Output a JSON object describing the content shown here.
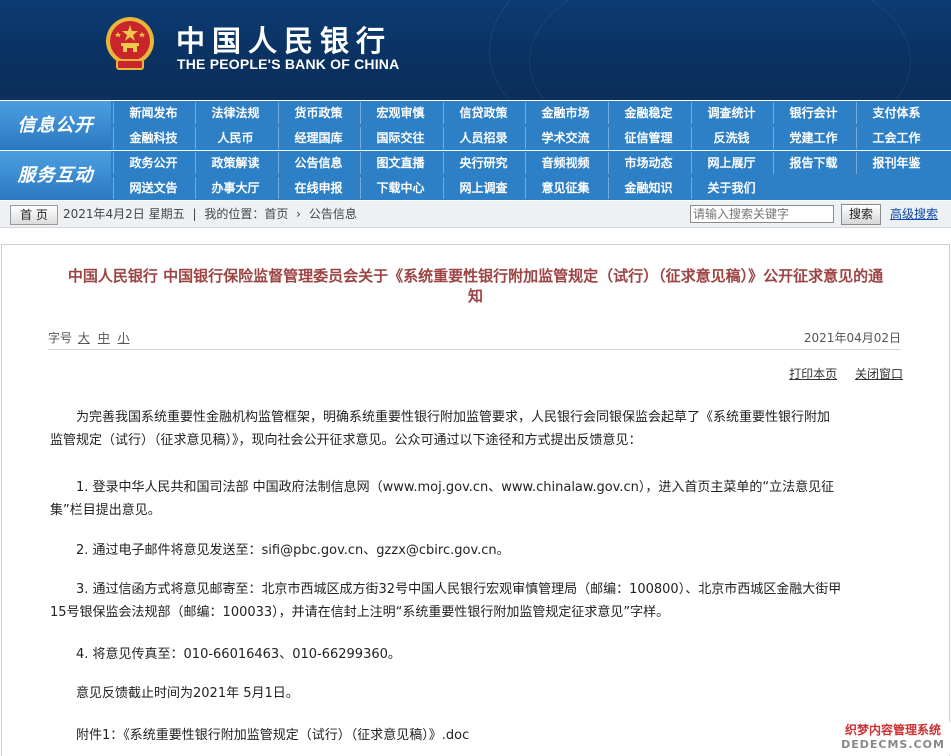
{
  "header": {
    "title_cn": "中国人民银行",
    "title_en": "THE PEOPLE'S BANK OF CHINA"
  },
  "nav": {
    "section1_label": "信息公开",
    "section1_row1": [
      "新闻发布",
      "法律法规",
      "货币政策",
      "宏观审慎",
      "信贷政策",
      "金融市场",
      "金融稳定",
      "调查统计",
      "银行会计",
      "支付体系"
    ],
    "section1_row2": [
      "金融科技",
      "人民币",
      "经理国库",
      "国际交往",
      "人员招录",
      "学术交流",
      "征信管理",
      "反洗钱",
      "党建工作",
      "工会工作"
    ],
    "section2_label": "服务互动",
    "section2_row1": [
      "政务公开",
      "政策解读",
      "公告信息",
      "图文直播",
      "央行研究",
      "音频视频",
      "市场动态",
      "网上展厅",
      "报告下载",
      "报刊年鉴"
    ],
    "section2_row2": [
      "网送文告",
      "办事大厅",
      "在线申报",
      "下载中心",
      "网上调查",
      "意见征集",
      "金融知识",
      "关于我们"
    ]
  },
  "breadcrumb": {
    "home_button": "首 页",
    "date": "2021年4月2日 星期五",
    "sep": "|",
    "location_label": "我的位置：首页",
    "arrow": "›",
    "current": "公告信息",
    "search_placeholder": "请输入搜索关键字",
    "search_button": "搜索",
    "advanced_search": "高级搜索"
  },
  "article": {
    "title_line1": "中国人民银行  中国银行保险监督管理委员会关于《系统重要性银行附加监管规定（试行）（征求意见稿）》公开征求意见的通",
    "title_line2": "知",
    "font_size_label": "字号",
    "font_large": "大",
    "font_medium": "中",
    "font_small": "小",
    "date": "2021年04月02日",
    "print_link": "打印本页",
    "close_link": "关闭窗口",
    "paragraphs": [
      {
        "l1": "为完善我国系统重要性金融机构监管框架，明确系统重要性银行附加监管要求，人民银行会同银保监会起草了《系统重要性银行附加",
        "l2": "监管规定（试行）（征求意见稿）》，现向社会公开征求意见。公众可通过以下途径和方式提出反馈意见："
      },
      {
        "l1": "1. 登录中华人民共和国司法部 中国政府法制信息网（www.moj.gov.cn、www.chinalaw.gov.cn），进入首页主菜单的“立法意见征",
        "l2": "集”栏目提出意见。"
      },
      {
        "l1": "2. 通过电子邮件将意见发送至：sifi@pbc.gov.cn、gzzx@cbirc.gov.cn。",
        "l2": ""
      },
      {
        "l1": "3. 通过信函方式将意见邮寄至：北京市西城区成方街32号中国人民银行宏观审慎管理局（邮编：100800）、北京市西城区金融大街甲",
        "l2": "15号银保监会法规部（邮编：100033），并请在信封上注明“系统重要性银行附加监管规定征求意见”字样。"
      },
      {
        "l1": "4. 将意见传真至：010-66016463、010-66299360。",
        "l2": ""
      },
      {
        "l1": "意见反馈截止时间为2021年 5月1日。",
        "l2": ""
      },
      {
        "l1": "附件1：《系统重要性银行附加监管规定（试行）（征求意见稿）》.doc",
        "l2": ""
      }
    ]
  },
  "watermark": {
    "line1": "织梦内容管理系统",
    "line2": "DEDECMS.COM"
  },
  "colors": {
    "header_bg": "#0b3465",
    "nav_bg": "#2d7fc6",
    "title_red": "#9c4444",
    "link_blue": "#0c46a8"
  }
}
